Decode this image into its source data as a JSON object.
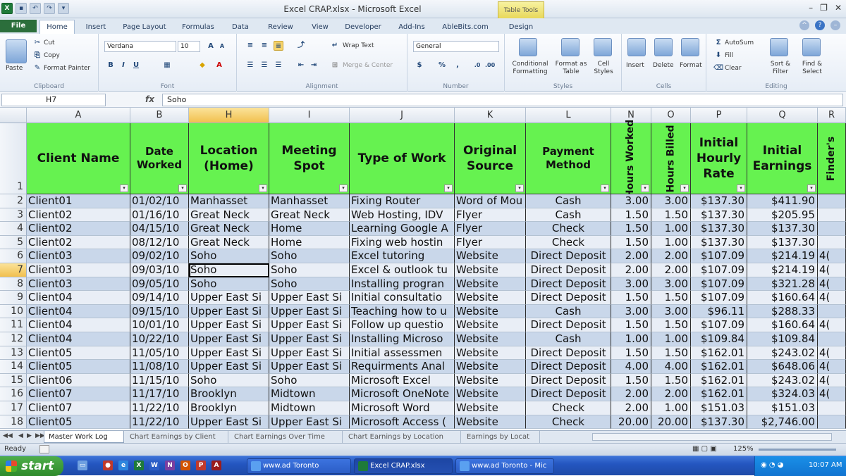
{
  "window": {
    "title": "Excel CRAP.xlsx - Microsoft Excel",
    "table_tools_label": "Table Tools",
    "controls": [
      "–",
      "❐",
      "✕"
    ]
  },
  "ribbon_tabs": [
    "File",
    "Home",
    "Insert",
    "Page Layout",
    "Formulas",
    "Data",
    "Review",
    "View",
    "Developer",
    "Add-Ins",
    "AbleBits.com",
    "Design"
  ],
  "ribbon": {
    "clipboard": {
      "paste": "Paste",
      "cut": "Cut",
      "copy": "Copy",
      "format_painter": "Format Painter",
      "label": "Clipboard"
    },
    "font": {
      "name": "Verdana",
      "size": "10",
      "label": "Font"
    },
    "alignment": {
      "wrap": "Wrap Text",
      "merge": "Merge & Center",
      "label": "Alignment"
    },
    "number": {
      "format": "General",
      "label": "Number"
    },
    "styles": {
      "conditional": "Conditional Formatting",
      "format_table": "Format as Table",
      "cell_styles": "Cell Styles",
      "label": "Styles"
    },
    "cells": {
      "insert": "Insert",
      "delete": "Delete",
      "format": "Format",
      "label": "Cells"
    },
    "editing": {
      "autosum": "AutoSum",
      "fill": "Fill",
      "clear": "Clear",
      "sort": "Sort & Filter",
      "find": "Find & Select",
      "label": "Editing"
    }
  },
  "formula_bar": {
    "name_box": "H7",
    "fx": "fx",
    "content": "Soho"
  },
  "columns": [
    "A",
    "B",
    "H",
    "I",
    "J",
    "K",
    "L",
    "N",
    "O",
    "P",
    "Q",
    "R"
  ],
  "selected_column": "H",
  "headers": [
    "Client Name",
    "Date Worked",
    "Location (Home)",
    "Meeting Spot",
    "Type of Work",
    "Original Source",
    "Payment Method",
    "Hours Worked",
    "Hours Billed",
    "Initial Hourly Rate",
    "Initial Earnings",
    "Finder's"
  ],
  "rows": [
    {
      "n": "2",
      "cells": [
        "Client01",
        "01/02/10",
        "Manhasset",
        "Manhasset",
        "Fixing Router",
        "Word of Mou",
        "Cash",
        "3.00",
        "3.00",
        "$137.30",
        "$411.90",
        ""
      ]
    },
    {
      "n": "3",
      "cells": [
        "Client02",
        "01/16/10",
        "Great Neck",
        "Great Neck",
        "Web Hosting, IDV",
        "Flyer",
        "Cash",
        "1.50",
        "1.50",
        "$137.30",
        "$205.95",
        ""
      ]
    },
    {
      "n": "4",
      "cells": [
        "Client02",
        "04/15/10",
        "Great Neck",
        "Home",
        "Learning Google A",
        "Flyer",
        "Check",
        "1.50",
        "1.00",
        "$137.30",
        "$137.30",
        ""
      ]
    },
    {
      "n": "5",
      "cells": [
        "Client02",
        "08/12/10",
        "Great Neck",
        "Home",
        "Fixing web hostin",
        "Flyer",
        "Check",
        "1.50",
        "1.00",
        "$137.30",
        "$137.30",
        ""
      ]
    },
    {
      "n": "6",
      "cells": [
        "Client03",
        "09/02/10",
        "Soho",
        "Soho",
        "Excel tutoring",
        "Website",
        "Direct Deposit",
        "2.00",
        "2.00",
        "$107.09",
        "$214.19",
        "4("
      ]
    },
    {
      "n": "7",
      "cells": [
        "Client03",
        "09/03/10",
        "Soho",
        "Soho",
        "Excel & outlook tu",
        "Website",
        "Direct Deposit",
        "2.00",
        "2.00",
        "$107.09",
        "$214.19",
        "4("
      ]
    },
    {
      "n": "8",
      "cells": [
        "Client03",
        "09/05/10",
        "Soho",
        "Soho",
        "Installing progran",
        "Website",
        "Direct Deposit",
        "3.00",
        "3.00",
        "$107.09",
        "$321.28",
        "4("
      ]
    },
    {
      "n": "9",
      "cells": [
        "Client04",
        "09/14/10",
        "Upper East Si",
        "Upper East Si",
        "Initial consultatio",
        "Website",
        "Direct Deposit",
        "1.50",
        "1.50",
        "$107.09",
        "$160.64",
        "4("
      ]
    },
    {
      "n": "10",
      "cells": [
        "Client04",
        "09/15/10",
        "Upper East Si",
        "Upper East Si",
        "Teaching how to u",
        "Website",
        "Cash",
        "3.00",
        "3.00",
        "$96.11",
        "$288.33",
        ""
      ]
    },
    {
      "n": "11",
      "cells": [
        "Client04",
        "10/01/10",
        "Upper East Si",
        "Upper East Si",
        "Follow up questio",
        "Website",
        "Direct Deposit",
        "1.50",
        "1.50",
        "$107.09",
        "$160.64",
        "4("
      ]
    },
    {
      "n": "12",
      "cells": [
        "Client04",
        "10/22/10",
        "Upper East Si",
        "Upper East Si",
        "Installing Microso",
        "Website",
        "Cash",
        "1.00",
        "1.00",
        "$109.84",
        "$109.84",
        ""
      ]
    },
    {
      "n": "13",
      "cells": [
        "Client05",
        "11/05/10",
        "Upper East Si",
        "Upper East Si",
        "Initial assessmen",
        "Website",
        "Direct Deposit",
        "1.50",
        "1.50",
        "$162.01",
        "$243.02",
        "4("
      ]
    },
    {
      "n": "14",
      "cells": [
        "Client05",
        "11/08/10",
        "Upper East Si",
        "Upper East Si",
        "Requirments Anal",
        "Website",
        "Direct Deposit",
        "4.00",
        "4.00",
        "$162.01",
        "$648.06",
        "4("
      ]
    },
    {
      "n": "15",
      "cells": [
        "Client06",
        "11/15/10",
        "Soho",
        "Soho",
        "Microsoft Excel",
        "Website",
        "Direct Deposit",
        "1.50",
        "1.50",
        "$162.01",
        "$243.02",
        "4("
      ]
    },
    {
      "n": "16",
      "cells": [
        "Client07",
        "11/17/10",
        "Brooklyn",
        "Midtown",
        "Microsoft OneNote",
        "Website",
        "Direct Deposit",
        "2.00",
        "2.00",
        "$162.01",
        "$324.03",
        "4("
      ]
    },
    {
      "n": "17",
      "cells": [
        "Client07",
        "11/22/10",
        "Brooklyn",
        "Midtown",
        "Microsoft Word",
        "Website",
        "Check",
        "2.00",
        "1.00",
        "$151.03",
        "$151.03",
        ""
      ]
    },
    {
      "n": "18",
      "cells": [
        "Client05",
        "11/22/10",
        "Upper East Si",
        "Upper East Si",
        "Microsoft Access (",
        "Website",
        "Check",
        "20.00",
        "20.00",
        "$137.30",
        "$2,746.00",
        ""
      ]
    }
  ],
  "active_cell": {
    "row": "7",
    "col": "H"
  },
  "sheet_tabs": [
    "Master Work Log",
    "Chart Earnings by Client",
    "Chart Earnings Over Time",
    "Chart Earnings by Location",
    "Earnings by Locat"
  ],
  "status": {
    "ready": "Ready",
    "zoom": "125%"
  },
  "taskbar": {
    "start": "start",
    "windows": [
      "www.ad Toronto",
      "Excel CRAP.xlsx",
      "www.ad Toronto - Mic"
    ],
    "clock": "10:07 AM"
  },
  "colors": {
    "header_green": "#66f250",
    "band_dark": "#c9d7ea",
    "band_light": "#e9eef6",
    "taskbar_blue": "#2456c0"
  }
}
